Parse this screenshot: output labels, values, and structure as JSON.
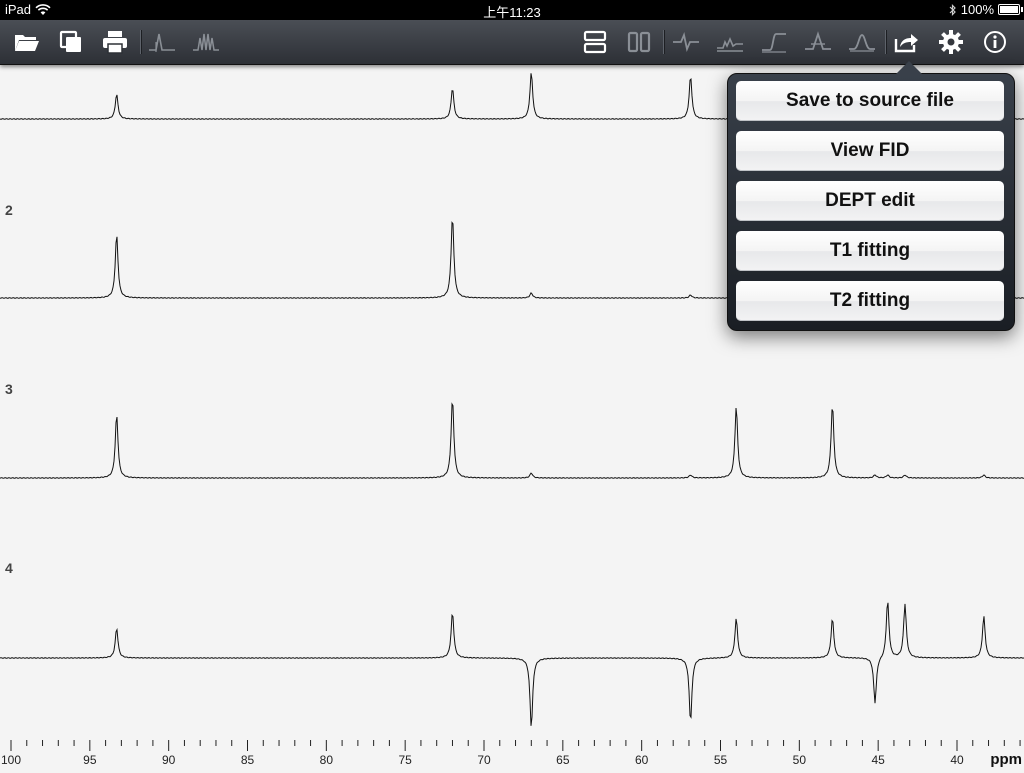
{
  "status_bar": {
    "device": "iPad",
    "time": "上午11:23",
    "battery": "100%",
    "battery_level": 1.0
  },
  "toolbar": {
    "icons": [
      "open-folder-icon",
      "copy-icon",
      "print-icon",
      "peak-pick-icon",
      "multiplet-icon",
      "stack-horizontal-icon",
      "stack-vertical-icon",
      "phase-icon",
      "baseline-icon",
      "integrate-icon",
      "peak-icon",
      "lineshape-icon",
      "share-icon",
      "gear-icon",
      "info-icon"
    ]
  },
  "spectrum": {
    "trace_labels": [
      "2",
      "3",
      "4"
    ],
    "axis_unit": "ppm",
    "axis_ticks": [
      "100",
      "95",
      "90",
      "85",
      "80",
      "75",
      "70",
      "65",
      "60",
      "55",
      "50",
      "45",
      "40"
    ]
  },
  "share_menu": {
    "items": [
      "Save to source file",
      "View FID",
      "DEPT edit",
      "T1 fitting",
      "T2 fitting"
    ]
  },
  "colors": {
    "toolbar_top": "#4a4e55",
    "toolbar_bottom": "#2d3036",
    "background": "#f4f4f4",
    "icon": "#ffffff",
    "icon_dim": "#8a8f96"
  }
}
